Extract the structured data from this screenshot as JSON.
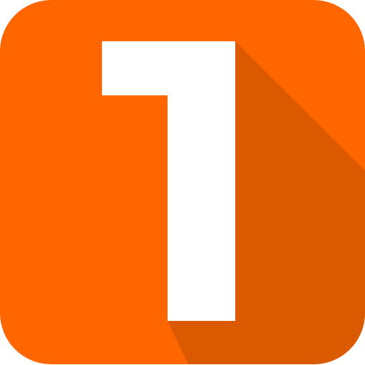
{
  "icon": {
    "glyph": "1",
    "semantic": "number-one-icon",
    "colors": {
      "background": "#FF6600",
      "shadow": "#DB5A00",
      "glyph": "#FFFFFF"
    }
  }
}
